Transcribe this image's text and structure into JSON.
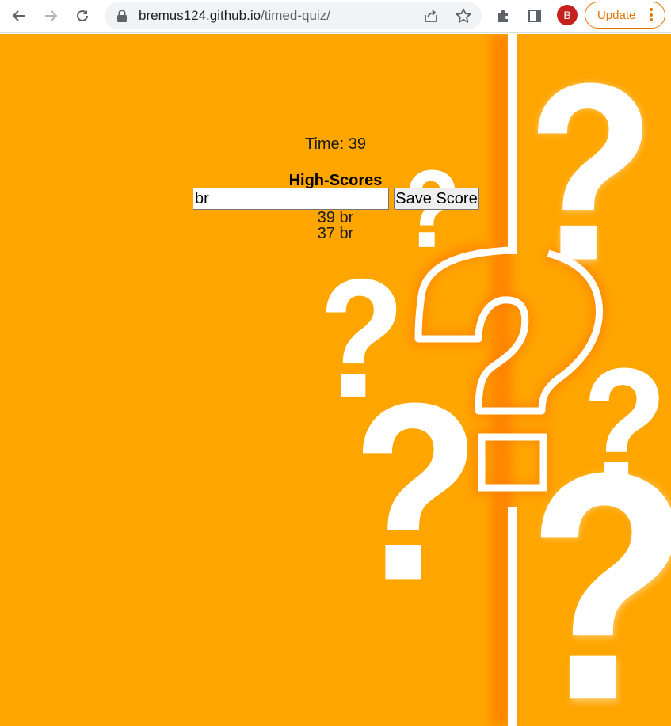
{
  "browser": {
    "url_host": "bremus124.github.io",
    "url_path": "/timed-quiz/",
    "profile_initial": "B",
    "update_label": "Update",
    "icons": [
      "back-icon",
      "forward-icon",
      "reload-icon",
      "lock-icon",
      "share-icon",
      "star-icon",
      "extensions-icon",
      "side-panel-icon",
      "menu-dots-icon"
    ],
    "colors": {
      "update": "#e37400",
      "avatar": "#c5221f"
    }
  },
  "page": {
    "background_color": "#ffa500",
    "timer_text": "Time: 39",
    "highscores_title": "High-Scores",
    "name_input_value": "br",
    "save_label": "Save Score",
    "scores": [
      "39 br",
      "37 br"
    ]
  }
}
